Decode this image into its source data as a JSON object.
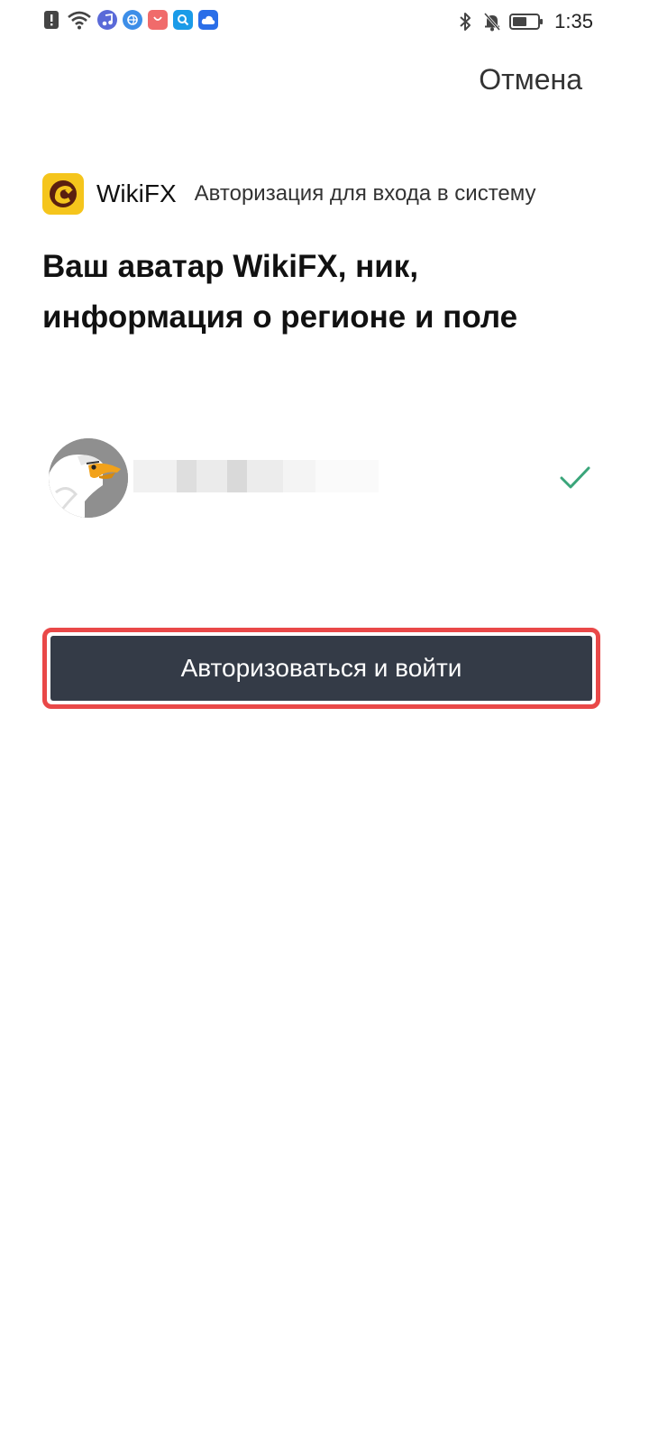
{
  "status_bar": {
    "time": "1:35",
    "left_icons": [
      "alert-icon",
      "wifi-icon",
      "music-app-icon",
      "browser-app-icon",
      "store-app-icon",
      "search-app-icon",
      "cloud-app-icon"
    ],
    "right_icons": [
      "bluetooth-icon",
      "bell-muted-icon",
      "battery-icon"
    ],
    "battery_level": 0.5
  },
  "header": {
    "cancel_label": "Отмена"
  },
  "app": {
    "name": "WikiFX",
    "subtitle": "Авторизация для входа в систему",
    "logo_color": "#f5c51c"
  },
  "permission": {
    "heading": "Ваш аватар WikiFX, ник, информация о регионе и поле"
  },
  "account": {
    "selected": true,
    "check_color": "#3aa57a"
  },
  "actions": {
    "authorize_label": "Авторизоваться и войти",
    "button_color": "#343b47",
    "highlight_color": "#e94848"
  }
}
